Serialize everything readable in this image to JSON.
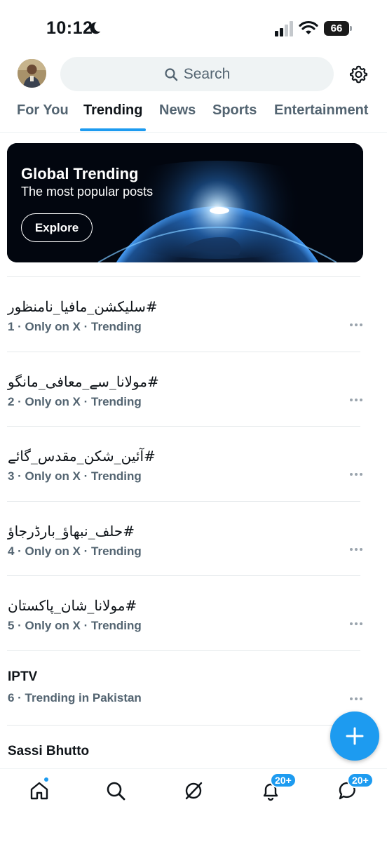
{
  "status_bar": {
    "time": "10:12",
    "battery": "66"
  },
  "header": {
    "search_placeholder": "Search",
    "icons": [
      "avatar",
      "search-icon",
      "gear-icon"
    ]
  },
  "tabs": [
    {
      "label": "For You",
      "active": false
    },
    {
      "label": "Trending",
      "active": true
    },
    {
      "label": "News",
      "active": false
    },
    {
      "label": "Sports",
      "active": false
    },
    {
      "label": "Entertainment",
      "active": false
    }
  ],
  "banner": {
    "title": "Global Trending",
    "subtitle": "The most popular posts",
    "button_label": "Explore"
  },
  "trends": [
    {
      "name": "#سلیکشن_مافیا_نامنظور",
      "meta": "1 · Only on X · Trending"
    },
    {
      "name": "#مولانا_سے_معافی_مانگو",
      "meta": "2 · Only on X · Trending"
    },
    {
      "name": "#آئین_شکن_مقدس_گائے",
      "meta": "3 · Only on X · Trending"
    },
    {
      "name": "#حلف_نبھاؤ_بارڈرجاؤ",
      "meta": "4 · Only on X · Trending"
    },
    {
      "name": "#مولانا_شان_پاکستان",
      "meta": "5 · Only on X · Trending"
    },
    {
      "name": "IPTV",
      "meta": "6 · Trending in Pakistan"
    },
    {
      "name": "Sassi Bhutto",
      "meta": ""
    }
  ],
  "bottom_nav": {
    "items": [
      "home-icon",
      "search-icon",
      "grok-icon",
      "bell-icon",
      "messages-icon"
    ],
    "notifications_badge": "20+",
    "messages_badge": "20+"
  },
  "colors": {
    "accent": "#1d9bf0",
    "secondary_text": "#536471",
    "primary_text": "#0f1419"
  }
}
